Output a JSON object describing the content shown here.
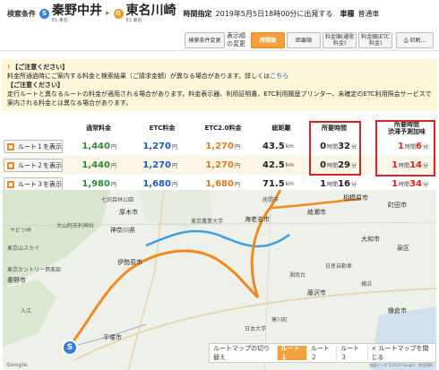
{
  "header": {
    "condition_label": "検索条件",
    "origin": {
      "badge": "S",
      "name": "秦野中井",
      "sub": "E1 東名"
    },
    "arrow": "▸",
    "destination": {
      "badge": "G",
      "name": "東名川崎",
      "sub": "E1 東名"
    },
    "time_label": "時間指定",
    "time_value": "2019年5月5日18時00分に出発する",
    "vehicle_label": "車種",
    "vehicle_value": "普通車"
  },
  "search_bar": {
    "change_button": "検索条件変更",
    "display_change_label": "表示順の変更",
    "sort_buttons": [
      "時間順",
      "距離順",
      "料金順(通常料金)",
      "料金順(ETC料金)"
    ],
    "print_button": "印刷..."
  },
  "notice": {
    "title1": "【ご注意ください】",
    "text1": "料金所通過時にご案内する料金と検索結果（ご請求金額）が異なる場合があります。詳しくは",
    "link1": "こちら",
    "title2": "【ご注意ください】",
    "text2": "走行ルートと異なるルートの料金が適用される場合があります。料金表示器、利用証明書、ETC利用履歴プリンター、未確定のETC利用照会サービスで案内される料金とは異なる場合があります。"
  },
  "table": {
    "headers": [
      "通常料金",
      "ETC料金",
      "ETC2.0料金",
      "総距離",
      "所要時間",
      "所要時間\n渋滞予測加味"
    ],
    "yen": "円",
    "km": "km",
    "routes": [
      {
        "button": "ルート１を表示",
        "normal": "1,440",
        "etc": "1,270",
        "etc2": "1,270",
        "dist": "43.5",
        "time_h": "0",
        "time_m": "32",
        "jam_h": "1",
        "jam_m": "6"
      },
      {
        "button": "ルート２を表示",
        "normal": "1,440",
        "etc": "1,270",
        "etc2": "1,270",
        "dist": "42.5",
        "time_h": "0",
        "time_m": "29",
        "jam_h": "1",
        "jam_m": "14"
      },
      {
        "button": "ルート３を表示",
        "normal": "1,980",
        "etc": "1,680",
        "etc2": "1,680",
        "dist": "71.5",
        "time_h": "1",
        "time_m": "16",
        "jam_h": "1",
        "jam_m": "34"
      }
    ],
    "hour_unit": "時間",
    "min_unit": "分"
  },
  "map": {
    "labels": [
      "七沢森林公園",
      "厚木市",
      "大山阿夫利神社",
      "神奈川県",
      "伊勢原市",
      "東京カントリー倶楽部",
      "秦野市",
      "綾瀬市",
      "海老名市",
      "座間市",
      "東京農業大学",
      "相模原市",
      "町田市",
      "大和市",
      "泉区",
      "鎌倉市",
      "藤沢市",
      "湘南台",
      "平塚市",
      "ヤビツ峠",
      "横浜",
      "寒川町",
      "日本大学",
      "入江",
      "東京山スカイ",
      "日産自動車"
    ],
    "start_badge": "S",
    "route_bar": {
      "label": "ルートマップの切り替え",
      "routes": [
        "ルート１",
        "ルート２",
        "ルート３"
      ],
      "close": "× ルートマップを閉じる"
    },
    "google": "Google",
    "copyright": "地図データ ©2019 Google　利用規約"
  }
}
